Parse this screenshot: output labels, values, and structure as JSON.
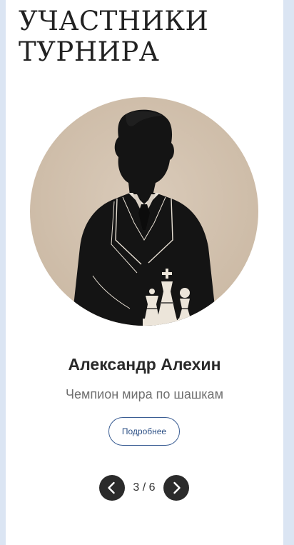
{
  "section": {
    "title": "УЧАСТНИКИ ТУРНИРА"
  },
  "player": {
    "name": "Александр Алехин",
    "title": "Чемпион мира по шашкам",
    "portrait_icon": "player-silhouette-with-chess-pieces"
  },
  "actions": {
    "more_label": "Подробнее"
  },
  "pager": {
    "counter": "3 / 6",
    "current": 3,
    "total": 6,
    "prev_icon": "chevron-left-icon",
    "next_icon": "chevron-right-icon"
  },
  "colors": {
    "background": "#dbe5f3",
    "panel": "#ffffff",
    "portrait_bg": "#d6c6b3",
    "button_border": "#3a5d93",
    "pager_button": "#2b2b2b"
  }
}
